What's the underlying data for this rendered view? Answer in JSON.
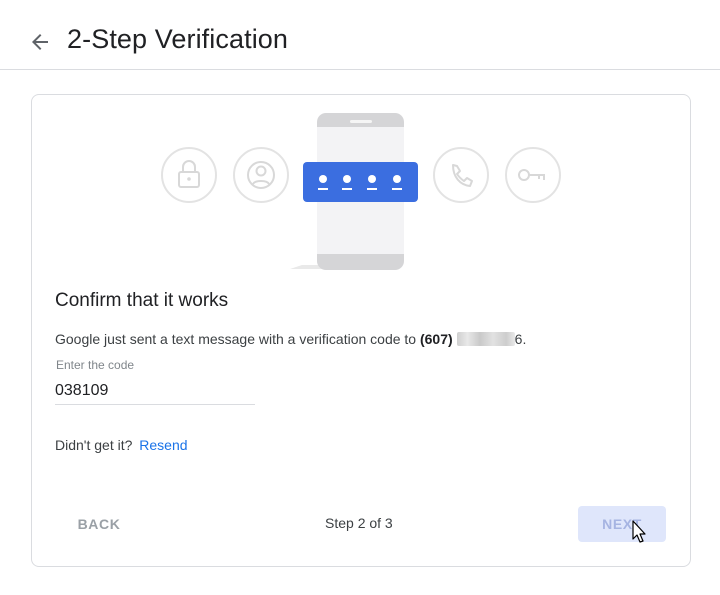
{
  "header": {
    "title": "2-Step Verification",
    "back_icon": "arrow-back-icon"
  },
  "illustration": {
    "icons": [
      "lock-icon",
      "account-icon",
      "phone-call-icon",
      "key-icon"
    ],
    "code_dots": 4,
    "accent": "#3b6ee0"
  },
  "content": {
    "heading": "Confirm that it works",
    "message_prefix": "Google just sent a text message with a verification code to ",
    "phone_area": "(607)",
    "phone_tail": "6",
    "message_end": ".",
    "field_label": "Enter the code",
    "code_value": "038109",
    "resend_prompt": "Didn't get it?",
    "resend_link": "Resend"
  },
  "footer": {
    "back_label": "BACK",
    "step_label": "Step 2 of 3",
    "next_label": "NEXT"
  },
  "colors": {
    "link": "#1a73e8",
    "next_bg": "#dfe6fb",
    "next_text": "#a6b4e2"
  }
}
